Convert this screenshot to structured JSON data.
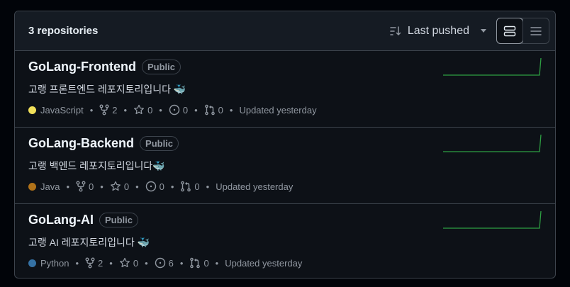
{
  "header": {
    "count_label": "3 repositories",
    "sort_label": "Last pushed",
    "sort_icon": "sort-desc-icon",
    "view_icons": [
      "rows-view-icon",
      "list-view-icon"
    ]
  },
  "repos": [
    {
      "name": "GoLang-Frontend",
      "visibility": "Public",
      "description": "고랭 프론트엔드 레포지토리입니다 🐳",
      "language": "JavaScript",
      "language_color": "#f1e05a",
      "forks": "2",
      "stars": "0",
      "issues": "0",
      "pulls": "0",
      "updated": "Updated yesterday"
    },
    {
      "name": "GoLang-Backend",
      "visibility": "Public",
      "description": "고랭 백엔드 레포지토리입니다🐳",
      "language": "Java",
      "language_color": "#b07219",
      "forks": "0",
      "stars": "0",
      "issues": "0",
      "pulls": "0",
      "updated": "Updated yesterday"
    },
    {
      "name": "GoLang-AI",
      "visibility": "Public",
      "description": "고랭 AI 레포지토리입니다 🐳",
      "language": "Python",
      "language_color": "#3572A5",
      "forks": "2",
      "stars": "0",
      "issues": "6",
      "pulls": "0",
      "updated": "Updated yesterday"
    }
  ],
  "colors": {
    "accent": "#2ea043",
    "border": "#3d444d",
    "muted": "#9198a1"
  }
}
